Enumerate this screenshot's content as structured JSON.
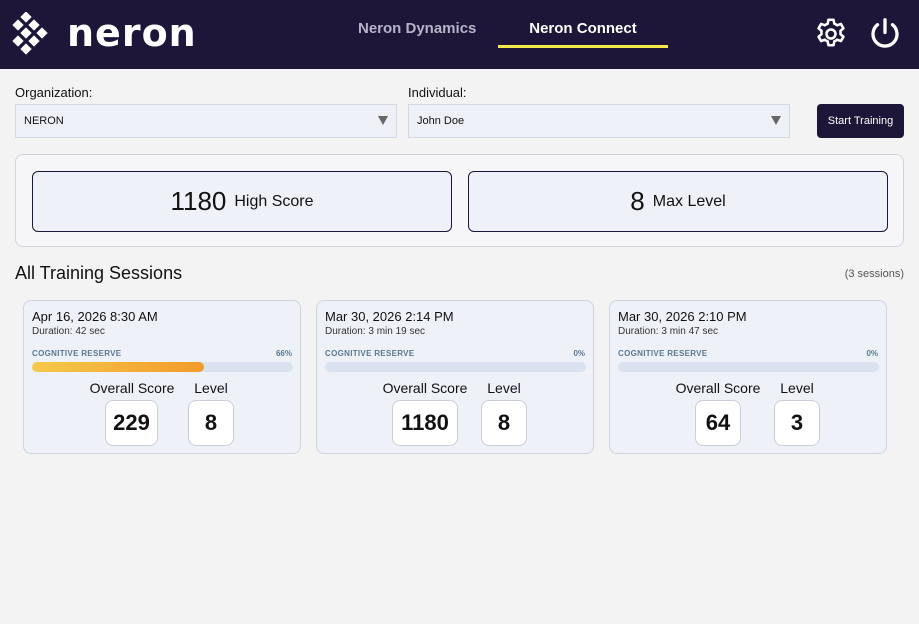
{
  "header": {
    "logo_text": "neron",
    "tabs": [
      {
        "label": "Neron Dynamics",
        "active": false
      },
      {
        "label": "Neron Connect",
        "active": true
      }
    ],
    "accent_color": "#f3e94a",
    "background_color": "#1d1638"
  },
  "filters": {
    "organization_label": "Organization:",
    "organization_value": "NERON",
    "individual_label": "Individual:",
    "individual_value": "John Doe",
    "start_button": "Start Training"
  },
  "summary": {
    "high_score_value": "1180",
    "high_score_label": "High Score",
    "max_level_value": "8",
    "max_level_label": "Max Level"
  },
  "sessions_section": {
    "title": "All Training Sessions",
    "count": "(3 sessions)"
  },
  "sessions": [
    {
      "date": "Apr 16, 2026  8:30 AM",
      "duration": "Duration: 42 sec",
      "reserve_label": "COGNITIVE RESERVE",
      "reserve_pct": "66%",
      "reserve_fraction": 0.66,
      "score_label": "Overall Score",
      "score": "229",
      "level_label": "Level",
      "level": "8"
    },
    {
      "date": "Mar 30, 2026  2:14 PM",
      "duration": "Duration: 3 min 19 sec",
      "reserve_label": "COGNITIVE RESERVE",
      "reserve_pct": "0%",
      "reserve_fraction": 0,
      "score_label": "Overall Score",
      "score": "1180",
      "level_label": "Level",
      "level": "8"
    },
    {
      "date": "Mar 30, 2026  2:10 PM",
      "duration": "Duration: 3 min 47 sec",
      "reserve_label": "COGNITIVE RESERVE",
      "reserve_pct": "0%",
      "reserve_fraction": 0,
      "score_label": "Overall Score",
      "score": "64",
      "level_label": "Level",
      "level": "3"
    }
  ],
  "icons": {
    "logo": "neron-logo-icon",
    "settings": "gear-icon",
    "power": "power-icon",
    "dropdown": "caret-down-icon"
  }
}
